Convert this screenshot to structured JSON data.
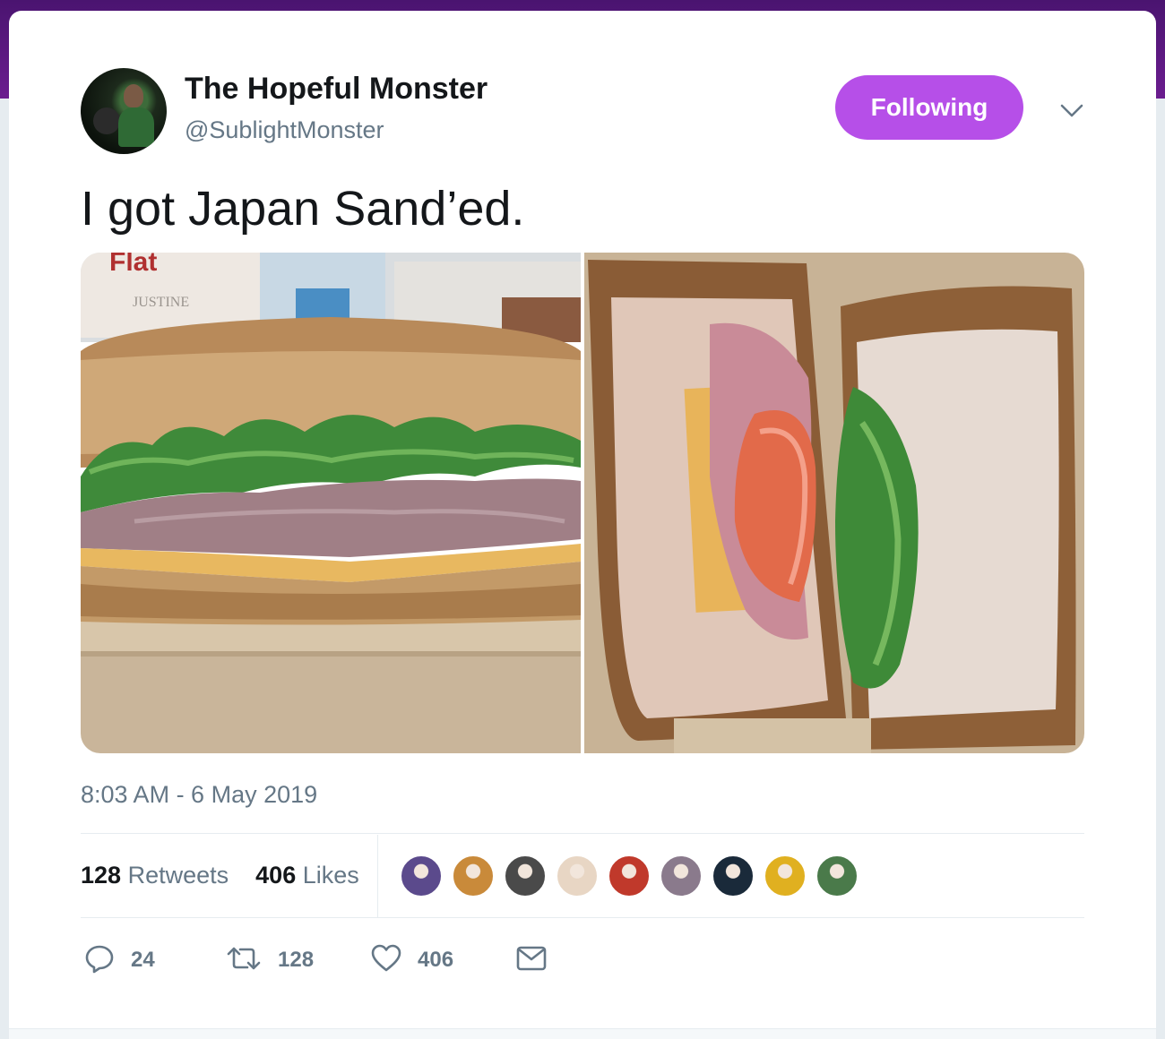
{
  "user": {
    "display_name": "The Hopeful Monster",
    "handle": "@SublightMonster"
  },
  "follow_button": {
    "label": "Following"
  },
  "tweet": {
    "text": "I got Japan Sand’ed.",
    "timestamp": "8:03 AM - 6 May 2019"
  },
  "media": {
    "left_photo": "sandwich-cross-section-photo",
    "right_photo": "open-sandwich-halves-photo",
    "printed_packaging_text": [
      "Flat",
      "JUSTINE"
    ]
  },
  "stats": {
    "retweets_count": "128",
    "retweets_label": "Retweets",
    "likes_count": "406",
    "likes_label": "Likes"
  },
  "likers": [
    {
      "icon": "anime-girl-avatar",
      "color": "#5b4a8c"
    },
    {
      "icon": "sunset-avatar",
      "color": "#c98a3a"
    },
    {
      "icon": "group-photo-avatar",
      "color": "#4a4a4a"
    },
    {
      "icon": "heart-face-avatar",
      "color": "#e8d6c4"
    },
    {
      "icon": "car-avatar",
      "color": "#c0392b"
    },
    {
      "icon": "portrait-avatar",
      "color": "#8a7a8c"
    },
    {
      "icon": "dark-portrait-avatar",
      "color": "#1a2a3a"
    },
    {
      "icon": "fist-avatar",
      "color": "#e0b020"
    },
    {
      "icon": "outdoor-avatar",
      "color": "#4a7a4a"
    }
  ],
  "actions": {
    "reply_count": "24",
    "retweet_count": "128",
    "like_count": "406"
  },
  "colors": {
    "accent": "#b64fe8",
    "text_primary": "#14171a",
    "text_secondary": "#657786"
  }
}
